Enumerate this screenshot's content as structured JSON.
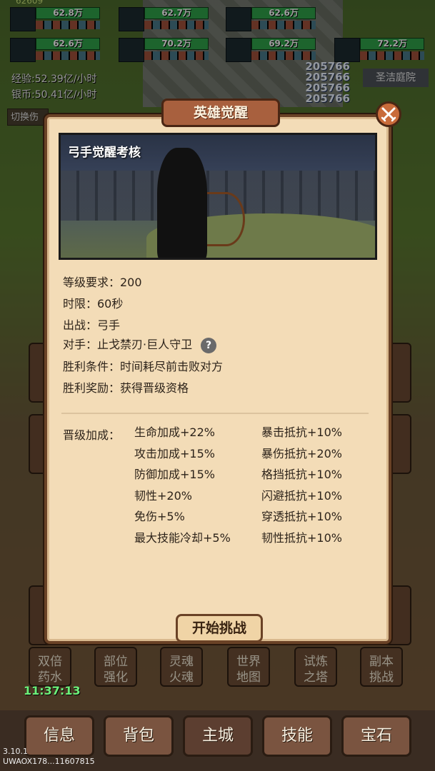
{
  "party": {
    "top_value": "62609",
    "members": [
      {
        "hp": "62.8万"
      },
      {
        "hp": "62.7万"
      },
      {
        "hp": "62.6万"
      },
      {
        "hp": "62.6万"
      },
      {
        "hp": "70.2万"
      },
      {
        "hp": "69.2万"
      },
      {
        "hp": "72.2万"
      }
    ]
  },
  "stats": {
    "exp_rate": "经验:52.39亿/小时",
    "silver_rate": "银币:50.41亿/小时",
    "switch_label": "切换伤"
  },
  "damage_numbers": [
    "205766",
    "205766",
    "205766",
    "205766"
  ],
  "location": "圣洁庭院",
  "modal": {
    "title": "英雄觉醒",
    "banner_title": "弓手觉醒考核",
    "level_req": "等级要求：200",
    "time_limit": "时限：60秒",
    "deploy": "出战：弓手",
    "opponent": "对手：止戈禁刃·巨人守卫",
    "win_condition": "胜利条件：时间耗尽前击败对方",
    "win_reward": "胜利奖励：获得晋级资格",
    "bonus_title": "晋级加成：",
    "bonuses_left": [
      "生命加成+22%",
      "攻击加成+15%",
      "防御加成+15%",
      "韧性+20%",
      "免伤+5%",
      "最大技能冷却+5%"
    ],
    "bonuses_right": [
      "暴击抵抗+10%",
      "暴伤抵抗+20%",
      "格挡抵抗+10%",
      "闪避抵抗+10%",
      "穿透抵抗+10%",
      "韧性抵抗+10%"
    ],
    "start_button": "开始挑战"
  },
  "underlay": {
    "features": [
      "双倍\n药水",
      "部位\n强化",
      "灵魂\n火魂",
      "世界\n地图",
      "试炼\n之塔",
      "副本\n挑战"
    ],
    "clock": "11:37:13"
  },
  "bottom_nav": [
    "信息",
    "背包",
    "主城",
    "技能",
    "宝石"
  ],
  "footer": {
    "version": "3.10.1",
    "user_id": "UWAOX178...11607815"
  },
  "icons": {
    "close": "crossed-swords-icon",
    "help": "question-circle-icon"
  }
}
